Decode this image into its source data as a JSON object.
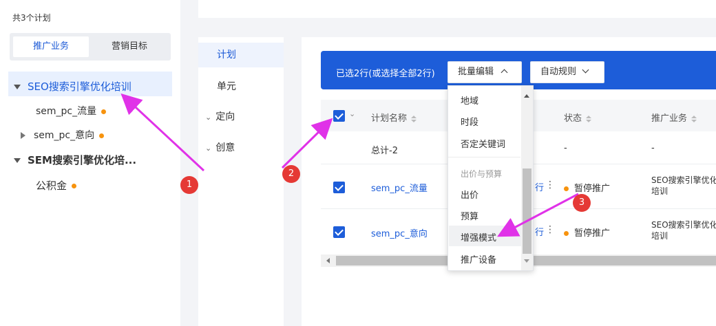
{
  "left_panel": {
    "plan_count": "共3个计划",
    "segment_tabs": [
      {
        "label": "推广业务",
        "active": true
      },
      {
        "label": "营销目标",
        "active": false
      }
    ],
    "tree": [
      {
        "label": "SEO搜索引擎优化培训",
        "expanded": true,
        "selected": true
      },
      {
        "label": "sem_pc_流量",
        "status_dot": "orange"
      },
      {
        "label": "sem_pc_意向",
        "status_dot": "orange",
        "collapsed": true
      },
      {
        "label": "SEM搜索引擎优化培...",
        "expanded": true
      },
      {
        "label": "公积金",
        "status_dot": "orange"
      }
    ]
  },
  "level_nav": {
    "items": [
      {
        "label": "计划",
        "active": true
      },
      {
        "label": "单元"
      },
      {
        "label": "定向",
        "expandable": true
      },
      {
        "label": "创意",
        "expandable": true
      }
    ]
  },
  "toolbar": {
    "selection_text": "已选2行(或选择全部2行)",
    "batch_edit_label": "批量编辑",
    "auto_rule_label": "自动规则"
  },
  "table": {
    "headers": [
      "计划名称",
      "状态",
      "推广业务"
    ],
    "total_row": {
      "name": "总计-2",
      "status": "-",
      "business": "-"
    },
    "rows": [
      {
        "name": "sem_pc_流量",
        "status": "暂停推广",
        "business_line1": "SEO搜索引擎优化",
        "business_line2": "培训",
        "checked": true
      },
      {
        "name": "sem_pc_意向",
        "status": "暂停推广",
        "business_line1": "SEO搜索引擎优化",
        "business_line2": "培训",
        "checked": true
      }
    ]
  },
  "batch_edit_menu": {
    "items_top": [
      "地域",
      "时段",
      "否定关键词"
    ],
    "group_label": "出价与预算",
    "items_bottom": [
      "出价",
      "预算",
      "增强模式",
      "推广设备"
    ],
    "highlighted": "增强模式"
  },
  "annotations": {
    "markers": [
      "1",
      "2",
      "3"
    ],
    "color": "#e53935",
    "arrow_color": "#e032e8"
  },
  "colors": {
    "primary": "#1d5dd9",
    "status_dot": "#f7930e"
  }
}
